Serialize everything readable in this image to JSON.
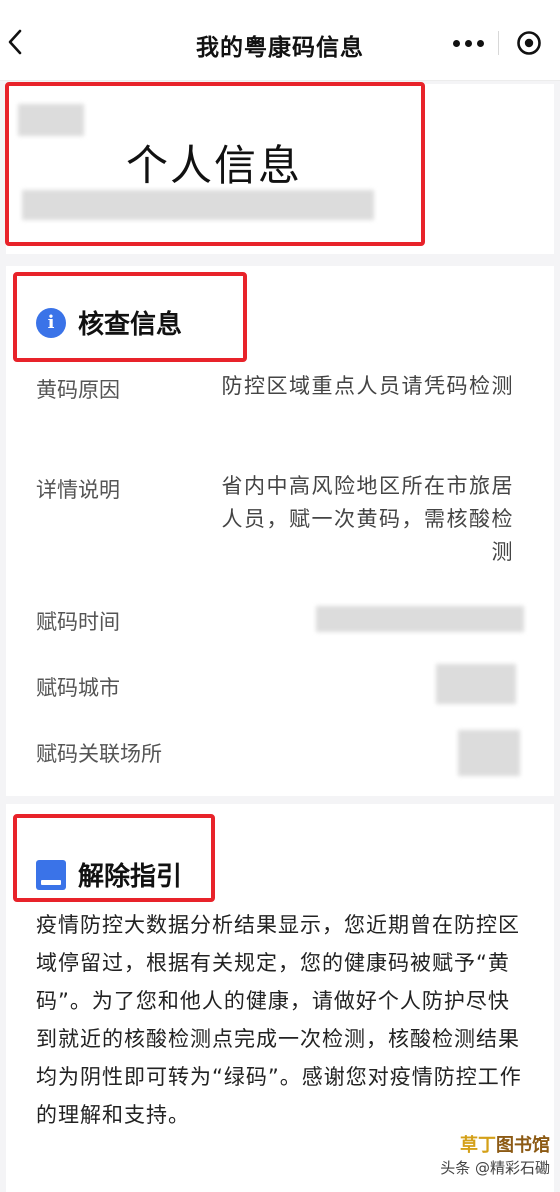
{
  "header": {
    "title": "我的粤康码信息"
  },
  "personal": {
    "title": "个人信息"
  },
  "verify": {
    "heading": "核查信息",
    "rows": [
      {
        "label": "黄码原因",
        "value": "防控区域重点人员请凭码检测"
      },
      {
        "label": "详情说明",
        "value": "省内中高风险地区所在市旅居人员，赋一次黄码，需核酸检测"
      },
      {
        "label": "赋码时间",
        "value": ""
      },
      {
        "label": "赋码城市",
        "value": ""
      },
      {
        "label": "赋码关联场所",
        "value": ""
      }
    ]
  },
  "guide": {
    "heading": "解除指引",
    "body": "疫情防控大数据分析结果显示，您近期曾在防控区域停留过，根据有关规定，您的健康码被赋予“黄码”。为了您和他人的健康，请做好个人防护尽快到就近的核酸检测点完成一次检测，核酸检测结果均为阴性即可转为“绿码”。感谢您对疫情防控工作的理解和支持。"
  },
  "watermark": {
    "brand_a": "草丁",
    "brand_b": "图书馆",
    "source": "头条 @精彩石磡"
  },
  "colors": {
    "accent_blue": "#3a73e8",
    "highlight_red": "#e8232a"
  },
  "icons": [
    "back-icon",
    "more-icon",
    "close-circle-icon",
    "info-icon",
    "book-icon"
  ]
}
